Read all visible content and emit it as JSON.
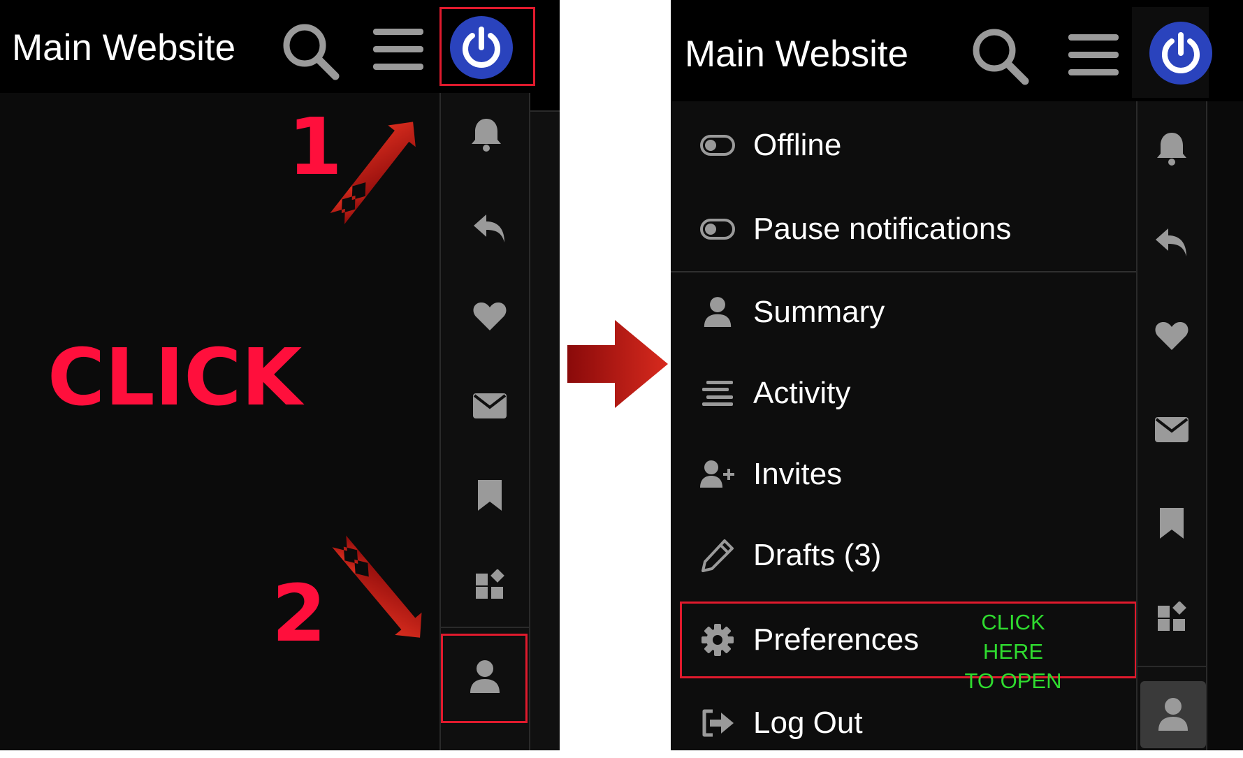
{
  "left": {
    "site_title": "Main Website",
    "step1": "1",
    "step2": "2",
    "click_text": "CLICK"
  },
  "right": {
    "site_title": "Main Website",
    "menu": [
      {
        "label": "Offline",
        "icon": "toggle-off-icon"
      },
      {
        "label": "Pause notifications",
        "icon": "toggle-off-icon"
      },
      {
        "label": "Summary",
        "icon": "user-icon"
      },
      {
        "label": "Activity",
        "icon": "stream-icon"
      },
      {
        "label": "Invites",
        "icon": "user-plus-icon"
      },
      {
        "label": "Drafts (3)",
        "icon": "pencil-icon"
      },
      {
        "label": "Preferences",
        "icon": "gear-icon"
      },
      {
        "label": "Log Out",
        "icon": "sign-out-icon"
      }
    ],
    "note_line1": "CLICK HERE",
    "note_line2": "TO OPEN"
  },
  "rail_icons": [
    "bell-icon",
    "reply-icon",
    "heart-icon",
    "envelope-icon",
    "bookmark-icon",
    "widgets-icon",
    "user-icon"
  ],
  "colors": {
    "avatar_blue": "#2a43bd",
    "icon_gray": "#9a9a9a",
    "highlight_red": "#e01a2d",
    "annotation_red": "#ff0f3c",
    "note_green": "#2fdc2f"
  }
}
